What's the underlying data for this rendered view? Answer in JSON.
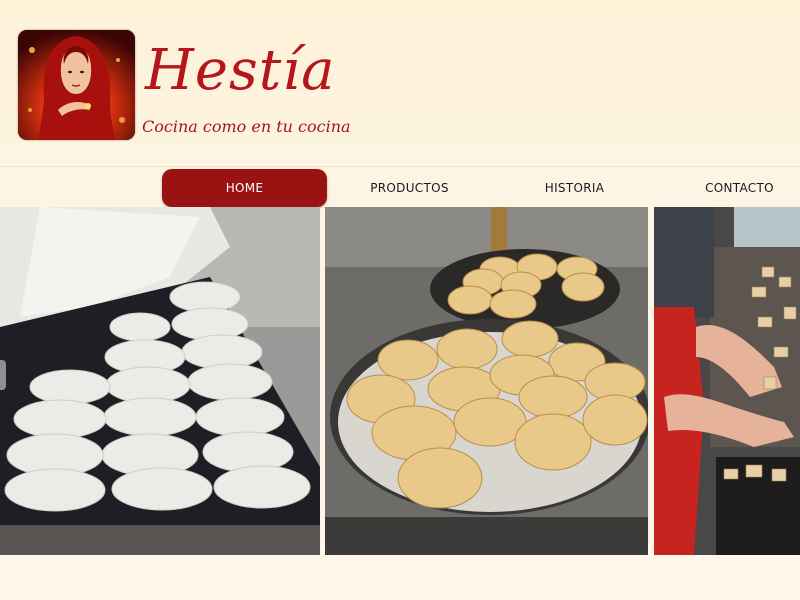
{
  "brand": {
    "name": "Hestía",
    "tagline": "Cocina como en tu cocina",
    "color": "#b5161c"
  },
  "nav": {
    "items": [
      {
        "label": "HOME",
        "active": true
      },
      {
        "label": "PRODUCTOS",
        "active": false
      },
      {
        "label": "HISTORIA",
        "active": false
      },
      {
        "label": "CONTACTO",
        "active": false
      }
    ],
    "active_color": "#9b1213"
  },
  "gallery": {
    "photos": [
      {
        "subject": "raw dough rolls on a baking tray"
      },
      {
        "subject": "baked bread rolls on round pans"
      },
      {
        "subject": "child shaping cookie dough"
      }
    ]
  }
}
